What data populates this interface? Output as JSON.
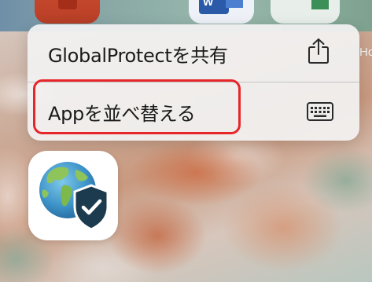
{
  "menu": {
    "share_label": "GlobalProtectを共有",
    "arrange_label": "Appを並べ替える"
  },
  "peek": {
    "side_text": "Ho"
  },
  "icons": {
    "share": "share-icon",
    "keyboard": "keyboard-icon",
    "app": "globalprotect-globe-shield-icon"
  },
  "colors": {
    "highlight": "#e6262b",
    "menu_bg": "#f2f2f2",
    "shield": "#1c3b4f"
  }
}
